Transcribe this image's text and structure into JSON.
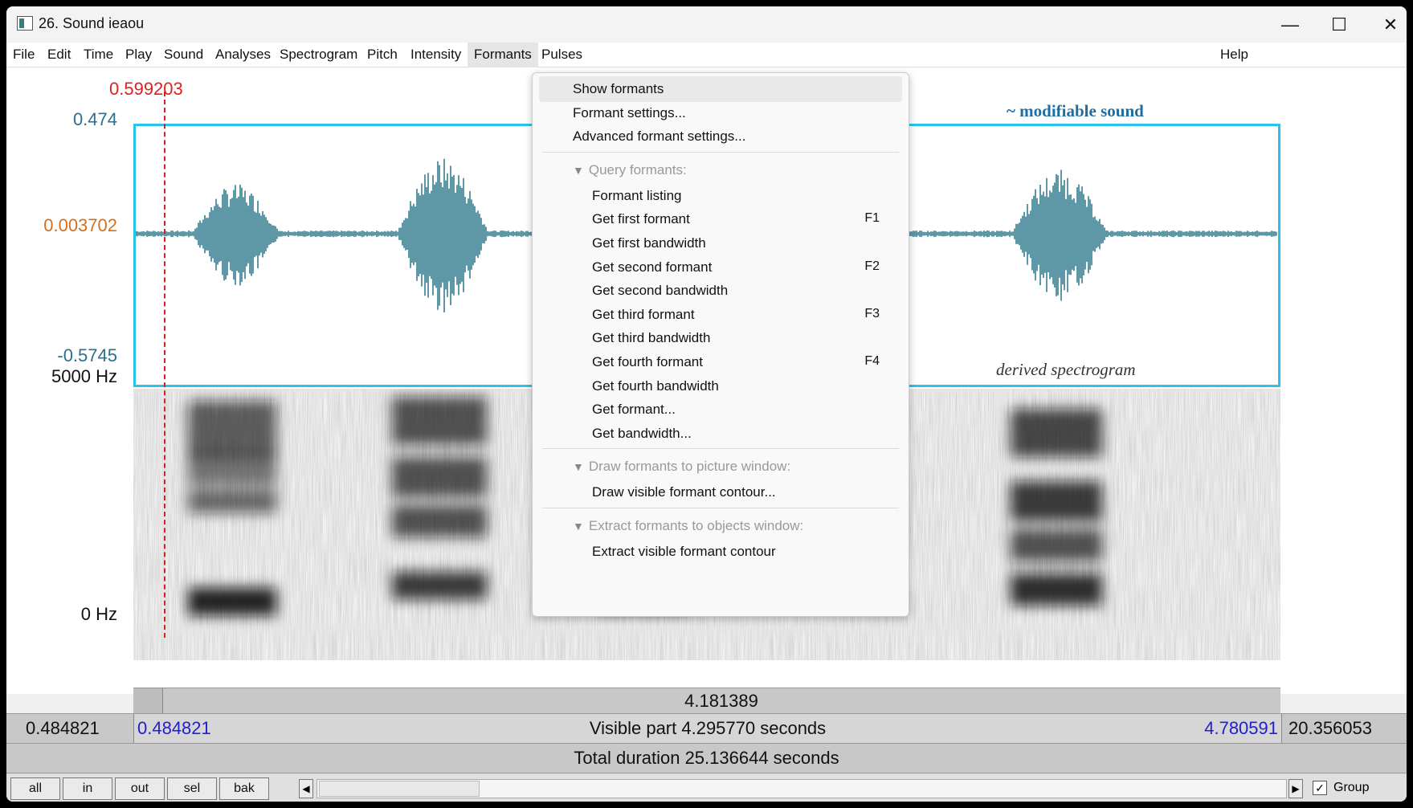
{
  "window": {
    "title": "26. Sound ieaou",
    "minimize": "—",
    "maximize": "☐",
    "close": "✕"
  },
  "menubar": {
    "items": [
      "File",
      "Edit",
      "Time",
      "Play",
      "Sound",
      "Analyses",
      "Spectrogram",
      "Pitch",
      "Intensity",
      "Formants",
      "Pulses"
    ],
    "active": "Formants",
    "help": "Help"
  },
  "editor": {
    "cursor_time": "0.599203",
    "wave_ymax": "0.474",
    "wave_ymid": "0.003702",
    "wave_ymin": "-0.5745",
    "wave_label": "~ modifiable sound",
    "spec_label": "derived spectrogram",
    "spec_ymax": "5000 Hz",
    "spec_ymin": "0 Hz",
    "wave_color": "#1a6b80",
    "border_color": "#29c4ea"
  },
  "formants_menu": {
    "items": [
      {
        "label": "Show formants",
        "shortcut": "",
        "type": "item",
        "highlight": true
      },
      {
        "label": "Formant settings...",
        "shortcut": "",
        "type": "item"
      },
      {
        "label": "Advanced formant settings...",
        "shortcut": "",
        "type": "item"
      },
      {
        "type": "sep"
      },
      {
        "label": "Query formants:",
        "shortcut": "",
        "type": "section"
      },
      {
        "label": "Formant listing",
        "shortcut": "",
        "type": "sub"
      },
      {
        "label": "Get first formant",
        "shortcut": "F1",
        "type": "sub"
      },
      {
        "label": "Get first bandwidth",
        "shortcut": "",
        "type": "sub"
      },
      {
        "label": "Get second formant",
        "shortcut": "F2",
        "type": "sub"
      },
      {
        "label": "Get second bandwidth",
        "shortcut": "",
        "type": "sub"
      },
      {
        "label": "Get third formant",
        "shortcut": "F3",
        "type": "sub"
      },
      {
        "label": "Get third bandwidth",
        "shortcut": "",
        "type": "sub"
      },
      {
        "label": "Get fourth formant",
        "shortcut": "F4",
        "type": "sub"
      },
      {
        "label": "Get fourth bandwidth",
        "shortcut": "",
        "type": "sub"
      },
      {
        "label": "Get formant...",
        "shortcut": "",
        "type": "sub"
      },
      {
        "label": "Get bandwidth...",
        "shortcut": "",
        "type": "sub"
      },
      {
        "type": "sep"
      },
      {
        "label": "Draw formants to picture window:",
        "shortcut": "",
        "type": "section"
      },
      {
        "label": "Draw visible formant contour...",
        "shortcut": "",
        "type": "sub"
      },
      {
        "type": "sep"
      },
      {
        "label": "Extract formants to objects window:",
        "shortcut": "",
        "type": "section"
      },
      {
        "label": "Extract visible formant contour",
        "shortcut": "",
        "type": "sub"
      }
    ]
  },
  "status": {
    "cursor_segment": "4.181389",
    "left_outside": "0.484821",
    "visible_start": "0.484821",
    "visible_part": "Visible part 4.295770 seconds",
    "visible_end": "4.780591",
    "right_outside": "20.356053",
    "total": "Total duration 25.136644 seconds"
  },
  "toolbar": {
    "buttons": [
      "all",
      "in",
      "out",
      "sel",
      "bak"
    ],
    "scroll_left": "◀",
    "scroll_right": "▶",
    "group_label": "Group",
    "group_checked": true
  }
}
